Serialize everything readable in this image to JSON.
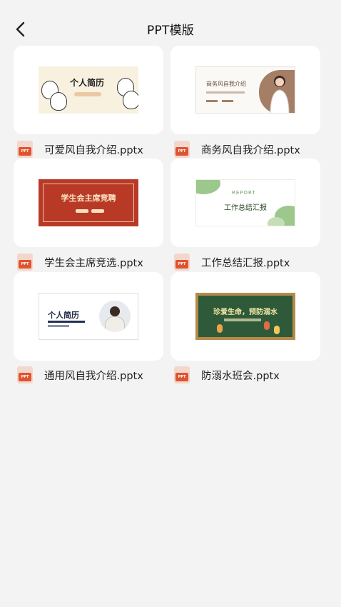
{
  "header": {
    "title": "PPT模版",
    "back_icon": "chevron-left-icon"
  },
  "file_icon": {
    "name": "pptx-file-icon",
    "badge": "PPT",
    "accent_color": "#e0532f"
  },
  "templates": [
    {
      "file_name": "可爱风自我介绍.pptx",
      "thumb_title": "个人简历"
    },
    {
      "file_name": "商务风自我介绍.pptx",
      "thumb_title": "商务风自我介绍"
    },
    {
      "file_name": "学生会主席竞选.pptx",
      "thumb_title": "学生会主席竞聘"
    },
    {
      "file_name": "工作总结汇报.pptx",
      "thumb_title": "工作总结汇报",
      "thumb_kicker": "REPORT"
    },
    {
      "file_name": "通用风自我介绍.pptx",
      "thumb_title": "个人简历"
    },
    {
      "file_name": "防溺水班会.pptx",
      "thumb_title": "珍爱生命，预防溺水"
    }
  ]
}
